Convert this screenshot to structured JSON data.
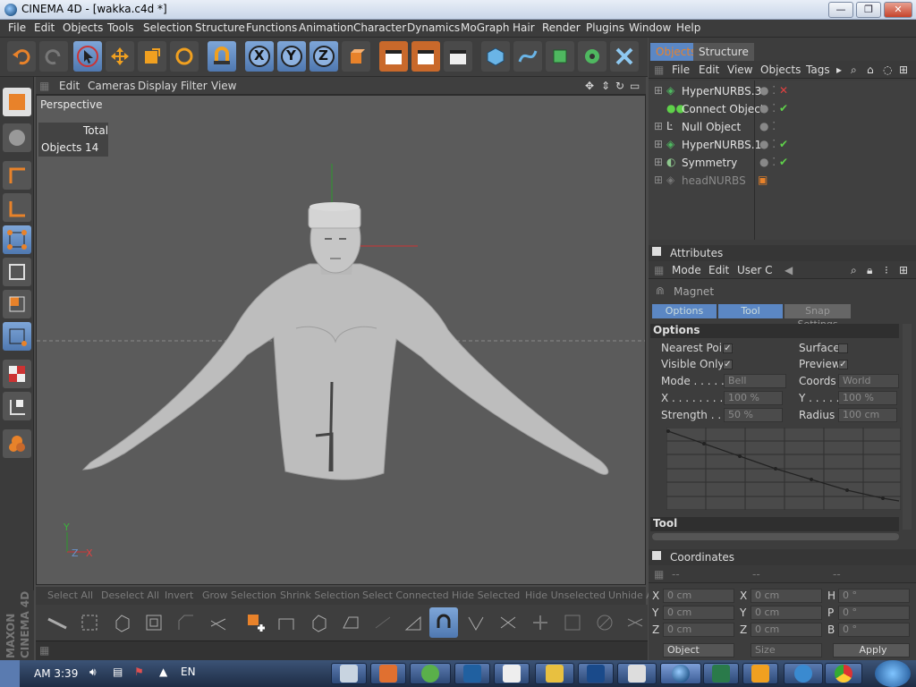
{
  "window": {
    "title": "CINEMA 4D - [wakka.c4d *]",
    "minimize": "—",
    "maximize": "❐",
    "close": "✕"
  },
  "menubar": [
    "File",
    "Edit",
    "Objects",
    "Tools",
    "Selection",
    "Structure",
    "Functions",
    "Animation",
    "Character",
    "Dynamics",
    "MoGraph",
    "Hair",
    "Render",
    "Plugins",
    "Window",
    "Help"
  ],
  "toolbar_axis": [
    "X",
    "Y",
    "Z"
  ],
  "viewport": {
    "menu": [
      "Edit",
      "Cameras",
      "Display",
      "Filter",
      "View"
    ],
    "label": "Perspective",
    "hud": {
      "header": "Total",
      "row_label": "Objects",
      "row_value": "14"
    }
  },
  "object_manager": {
    "tabs": [
      "Objects",
      "Structure"
    ],
    "menu": [
      "File",
      "Edit",
      "View",
      "Objects",
      "Tags"
    ],
    "objects": [
      {
        "name": "HyperNURBS.3",
        "status": "✕",
        "status_color": "#e04040"
      },
      {
        "name": "Connect Object",
        "status": "✔",
        "status_color": "#5fd14a"
      },
      {
        "name": "Null Object",
        "status": "",
        "status_color": "#5fd14a"
      },
      {
        "name": "HyperNURBS.1",
        "status": "✔",
        "status_color": "#5fd14a"
      },
      {
        "name": "Symmetry",
        "status": "✔",
        "status_color": "#5fd14a"
      },
      {
        "name": "headNURBS",
        "status": "",
        "status_color": "#888888"
      }
    ]
  },
  "attributes": {
    "header": "Attributes",
    "menu": [
      "Mode",
      "Edit",
      "User C"
    ],
    "tool_name": "Magnet",
    "tabs": [
      "Options",
      "Tool",
      "Snap Settings"
    ],
    "section_options": "Options",
    "nearest_point": "Nearest Point",
    "surface": "Surface",
    "visible_only": "Visible Only",
    "preview": "Preview",
    "mode_label": "Mode . . . . . .",
    "mode_value": "Bell",
    "coords_label": "Coords",
    "coords_value": "World",
    "x_label": "X . . . . . . . . .",
    "x_value": "100 %",
    "y_label": "Y . . . . . .",
    "y_value": "100 %",
    "strength_label": "Strength . . . .",
    "strength_value": "50 %",
    "radius_label": "Radius",
    "radius_value": "100 cm",
    "section_tool": "Tool"
  },
  "coordinates": {
    "header": "Coordinates",
    "rows": [
      {
        "l1": "X",
        "v1": "0 cm",
        "l2": "X",
        "v2": "0 cm",
        "l3": "H",
        "v3": "0 °"
      },
      {
        "l1": "Y",
        "v1": "0 cm",
        "l2": "Y",
        "v2": "0 cm",
        "l3": "P",
        "v3": "0 °"
      },
      {
        "l1": "Z",
        "v1": "0 cm",
        "l2": "Z",
        "v2": "0 cm",
        "l3": "B",
        "v3": "0 °"
      }
    ],
    "mode": "Object",
    "size": "Size",
    "apply": "Apply"
  },
  "bottom_commands": [
    "Select All",
    "Deselect All",
    "Invert",
    "Grow Selection",
    "Shrink Selection",
    "Select Connected",
    "Hide Selected",
    "Hide Unselected",
    "Unhide A"
  ],
  "taskbar": {
    "time": "AM 3:39",
    "lang": "EN"
  },
  "colors": {
    "accent_orange": "#e8822a",
    "accent_blue": "#6b93cc",
    "selection_blue": "#5b87c4"
  }
}
